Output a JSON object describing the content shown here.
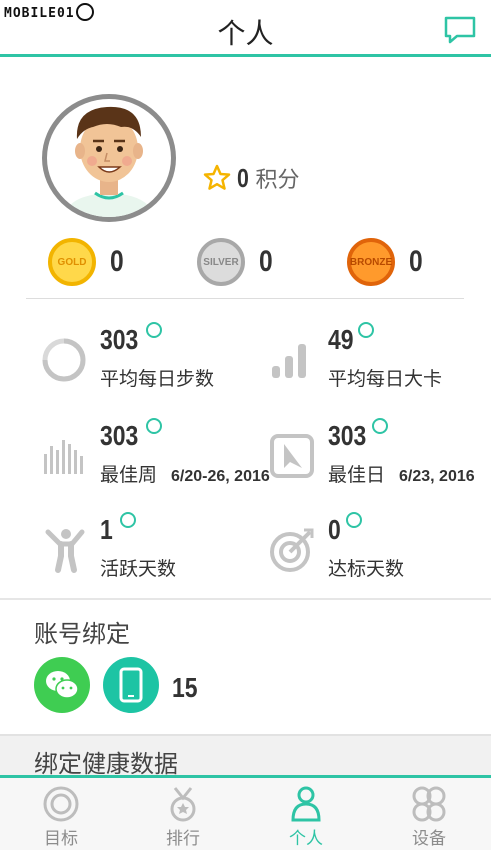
{
  "watermark": "MOBILE01",
  "header": {
    "title": "个人"
  },
  "profile": {
    "points_value": "0",
    "points_label": "积分",
    "medals": [
      {
        "badge": "GOLD",
        "count": "0"
      },
      {
        "badge": "SILVER",
        "count": "0"
      },
      {
        "badge": "BRONZE",
        "count": "0"
      }
    ]
  },
  "stats": {
    "steps": {
      "value": "303",
      "label": "平均每日步数"
    },
    "calories": {
      "value": "49",
      "label": "平均每日大卡"
    },
    "best_week": {
      "value": "303",
      "label": "最佳周",
      "date": "6/20-26, 2016"
    },
    "best_day": {
      "value": "303",
      "label": "最佳日",
      "date": "6/23, 2016"
    },
    "active_days": {
      "value": "1",
      "label": "活跃天数"
    },
    "goal_days": {
      "value": "0",
      "label": "达标天数"
    }
  },
  "account": {
    "title": "账号绑定",
    "number": "15"
  },
  "health": {
    "title": "绑定健康数据"
  },
  "nav": {
    "items": [
      {
        "label": "目标"
      },
      {
        "label": "排行"
      },
      {
        "label": "个人"
      },
      {
        "label": "设备"
      }
    ]
  },
  "colors": {
    "accent": "#2ec4a5",
    "gold": "#ffd84a",
    "silver": "#dcdcdc",
    "bronze": "#ff9a2c",
    "wechat": "#3fcd52"
  }
}
